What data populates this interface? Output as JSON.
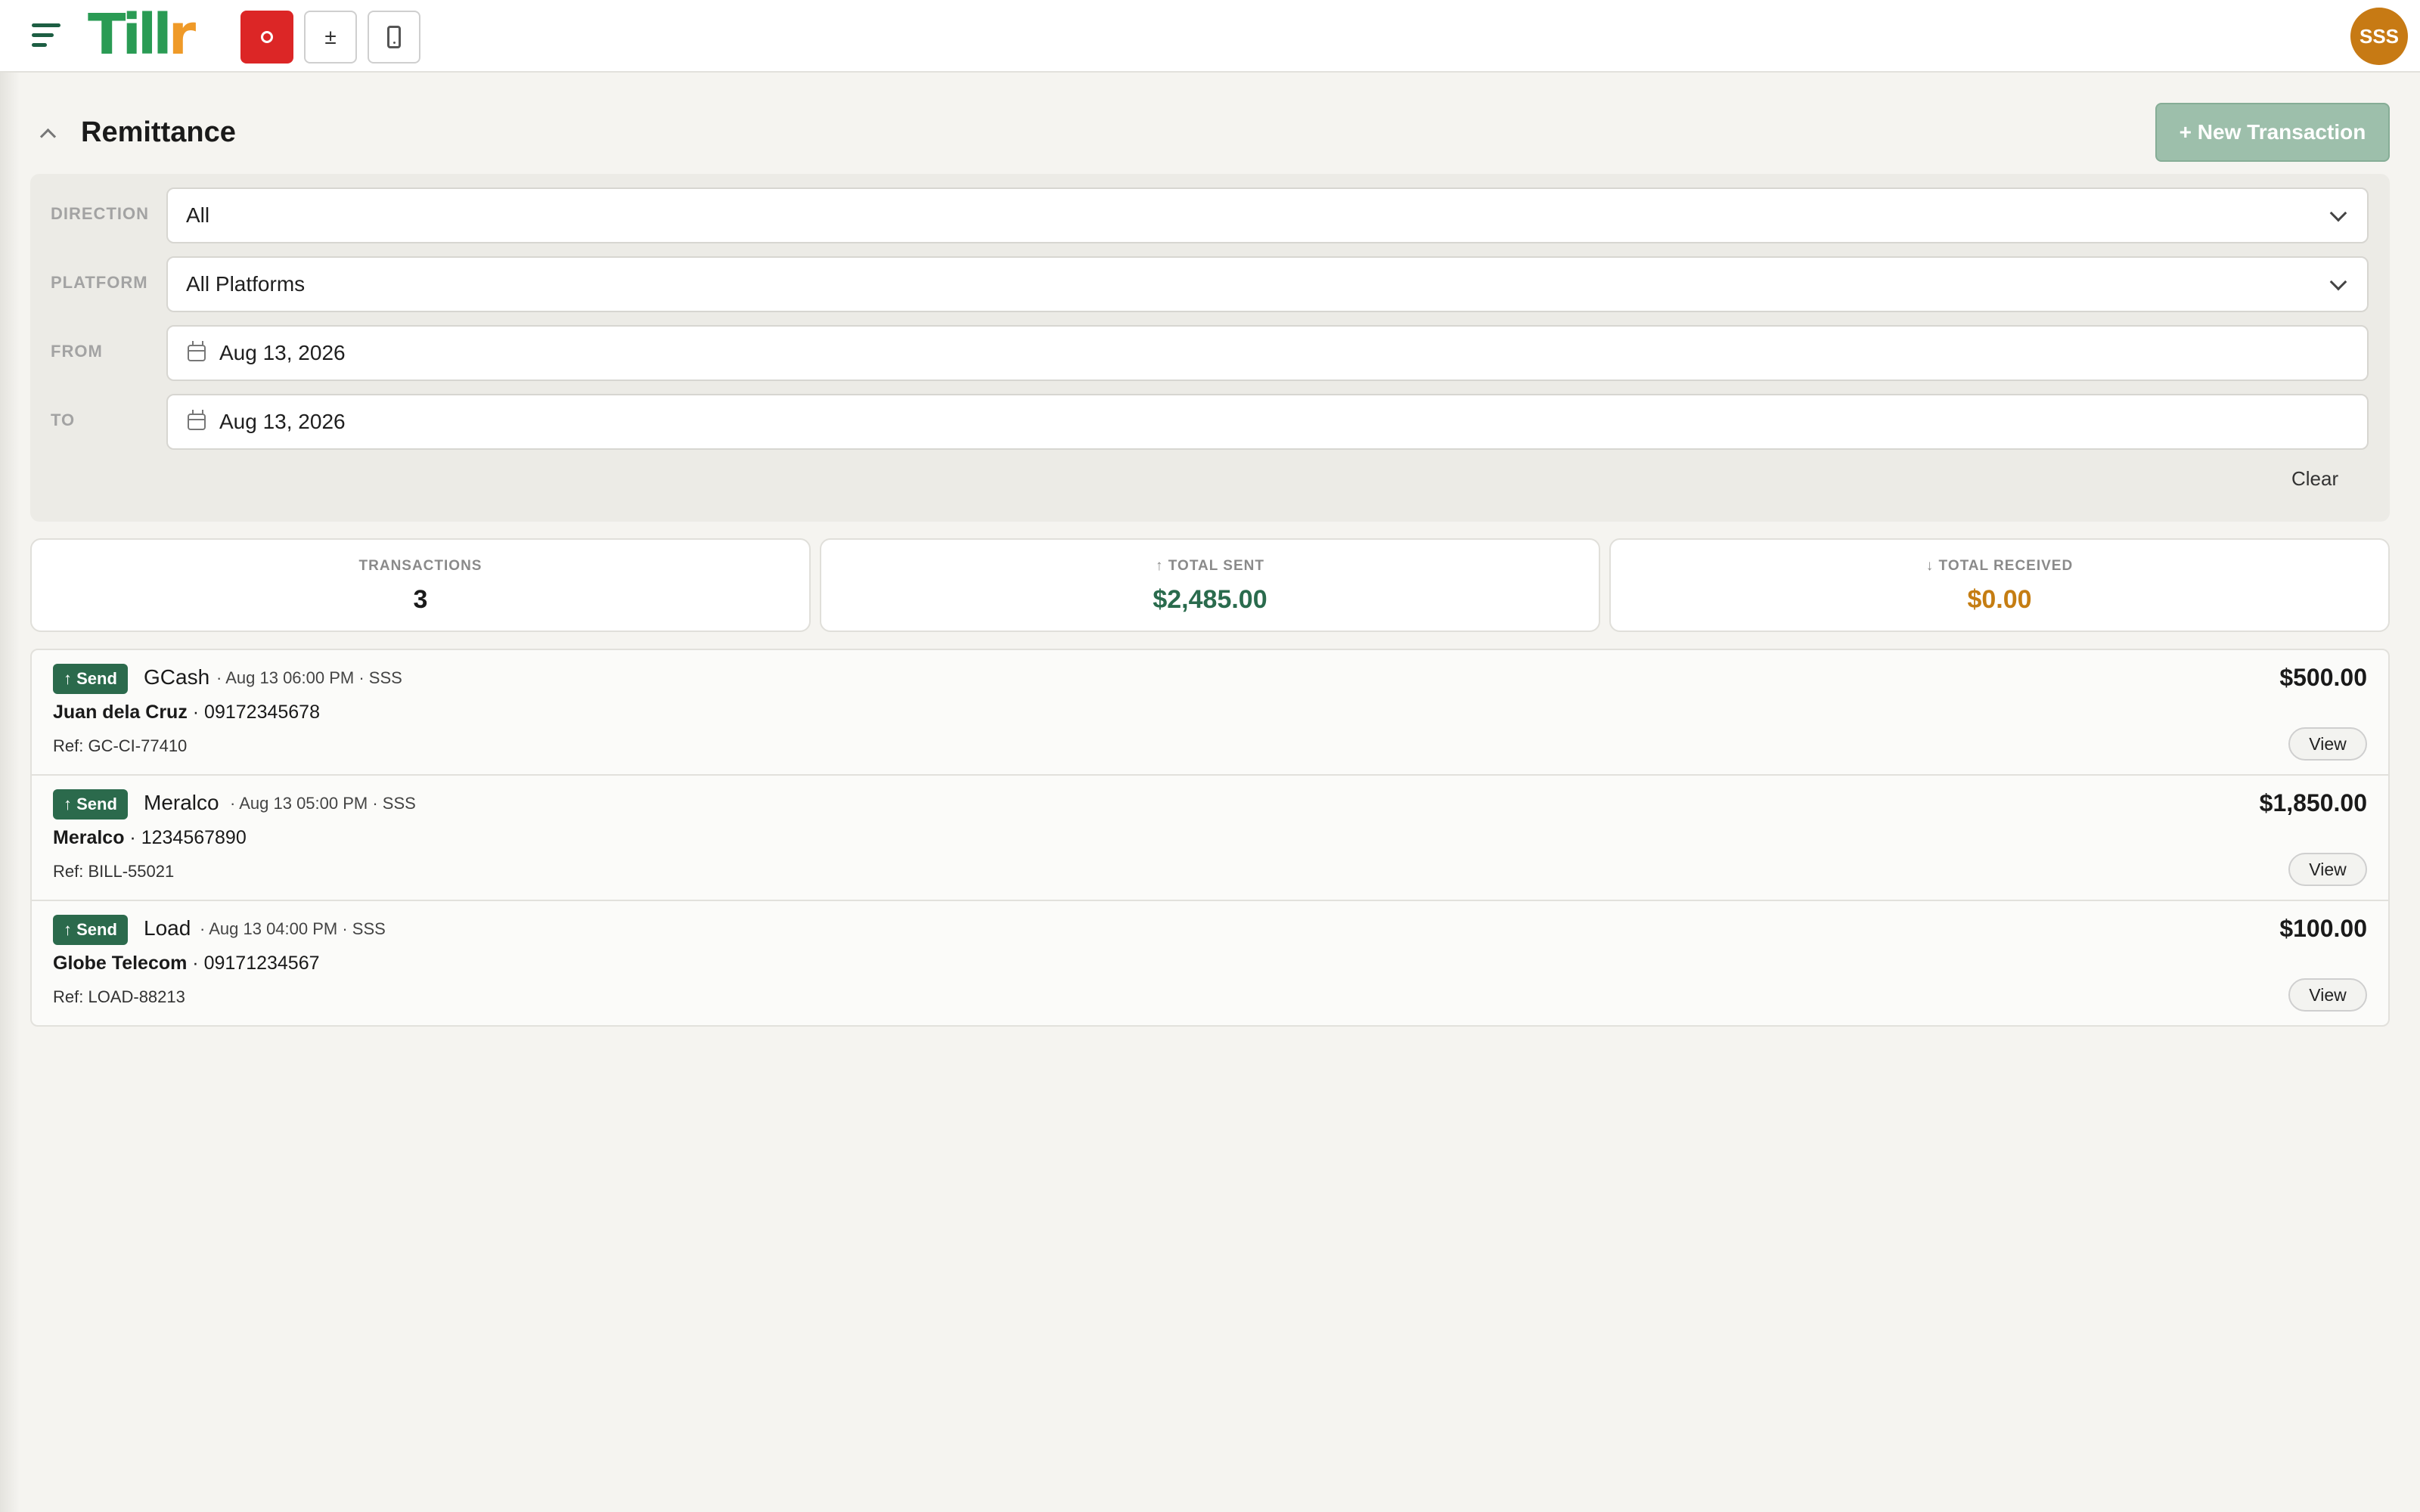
{
  "app": {
    "logo_text_main": "Till",
    "logo_text_accent": "r",
    "avatar_initials": "SSS"
  },
  "toolbar": {
    "icons": [
      "menu-icon",
      "record-icon",
      "plus-minus-icon",
      "phone-icon"
    ],
    "plus_minus_glyph": "±"
  },
  "header": {
    "title": "Remittance",
    "new_transaction_label": "+ New Transaction"
  },
  "filters": {
    "direction": {
      "label": "DIRECTION",
      "value": "All"
    },
    "platform": {
      "label": "PLATFORM",
      "value": "All Platforms"
    },
    "from": {
      "label": "FROM",
      "value": "Aug 13, 2026"
    },
    "to": {
      "label": "TO",
      "value": "Aug 13, 2026"
    },
    "clear_label": "Clear"
  },
  "stats": {
    "transactions": {
      "label": "TRANSACTIONS",
      "value": "3"
    },
    "total_sent": {
      "label": "↑ TOTAL SENT",
      "value": "$2,485.00"
    },
    "total_received": {
      "label": "↓ TOTAL RECEIVED",
      "value": "$0.00"
    }
  },
  "transactions": [
    {
      "badge": "↑ Send",
      "platform": "GCash",
      "meta": "· Aug 13 06:00 PM · SSS",
      "recipient_name": "Juan dela Cruz",
      "recipient_account": " · 09172345678",
      "ref": "Ref: GC-CI-77410",
      "amount": "$500.00",
      "view_label": "View"
    },
    {
      "badge": "↑ Send",
      "platform": "Meralco",
      "meta": "· Aug 13 05:00 PM · SSS",
      "recipient_name": "Meralco",
      "recipient_account": " · 1234567890",
      "ref": "Ref: BILL-55021",
      "amount": "$1,850.00",
      "view_label": "View"
    },
    {
      "badge": "↑ Send",
      "platform": "Load",
      "meta": "· Aug 13 04:00 PM · SSS",
      "recipient_name": "Globe Telecom",
      "recipient_account": " · 09171234567",
      "ref": "Ref: LOAD-88213",
      "amount": "$100.00",
      "view_label": "View"
    }
  ],
  "colors": {
    "brand_green": "#2a9b54",
    "brand_orange": "#ef9a28",
    "send_badge": "#2b6a4c",
    "record_red": "#dc2626",
    "avatar": "#c77a14",
    "total_sent": "#2a6b4d",
    "total_received": "#c57d12"
  }
}
